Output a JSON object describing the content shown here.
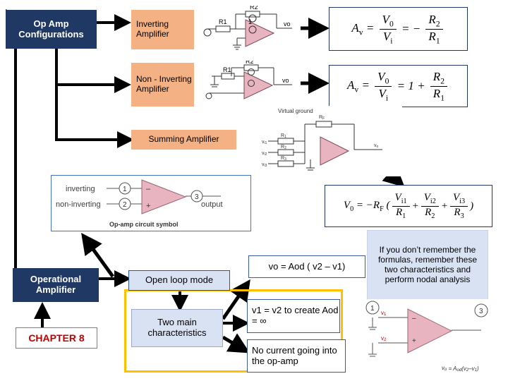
{
  "title": "Op Amp Configurations slide",
  "nodes": {
    "op_amp_configurations": "Op Amp Configurations",
    "inverting_amplifier": "Inverting Amplifier",
    "non_inverting_amplifier": "Non - Inverting Amplifier",
    "summing_amplifier": "Summing Amplifier",
    "operational_amplifier": "Operational Amplifier",
    "chapter": "CHAPTER 8",
    "open_loop_mode": "Open loop mode",
    "two_main_characteristics": "Two main characteristics",
    "vo_equation": "vo = Aod ( v2 – v1)",
    "v1_v2_equation": "v1 = v2 to create Aod = ∞",
    "no_current": "No current going into the op-amp",
    "remember_note": "If you don’t remember the formulas, remember these two characteristics and perform nodal analysis"
  },
  "formulas": {
    "inverting": "Av = V0 / Vi = − R2 / R1",
    "non_inverting": "Av = V0 / Vi = 1 + R2 / R1",
    "summing": "V0 = − RF ( Vi1/R1 + Vi2/R2 + Vi3/R3 )"
  },
  "figures": {
    "inverting_circuit": "inverting-amplifier-circuit-diagram",
    "non_inverting_circuit": "non-inverting-amplifier-circuit-diagram",
    "summing_circuit": "summing-amplifier-circuit-diagram",
    "opamp_symbol": "op-amp-circuit-symbol-diagram",
    "opamp_small": "op-amp-open-loop-diagram"
  },
  "opamp_symbol_labels": {
    "inverting": "inverting",
    "non_inverting": "non-inverting",
    "output": "output",
    "caption": "Op-amp circuit symbol",
    "pin1": "1",
    "pin2": "2",
    "pin3": "3"
  },
  "summing_labels": {
    "virtual_ground": "Virtual ground",
    "vi1": "vi1",
    "vi2": "vi2",
    "vi3": "vi3",
    "r1": "R1",
    "r2": "R2",
    "r3": "R3",
    "rf": "RF",
    "vo": "vo"
  },
  "colors": {
    "navy": "#1f3864",
    "peach": "#f4b183",
    "light_blue": "#d9e2f3",
    "accent_orange": "#ffc000",
    "chapter_red": "#c00000",
    "opamp_triangle": "#e8b4c0"
  }
}
